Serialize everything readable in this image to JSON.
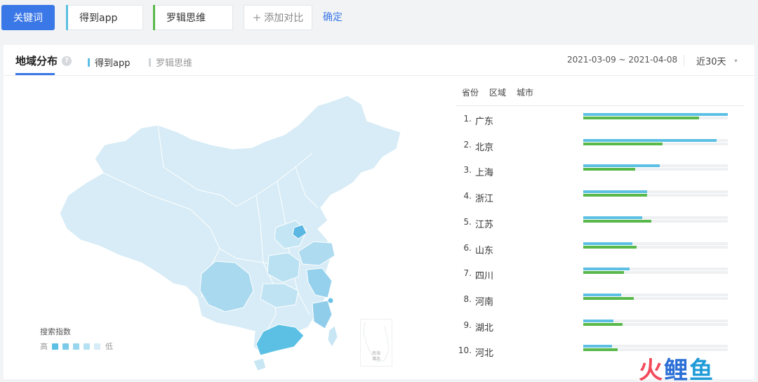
{
  "toolbar": {
    "keyword_button": "关键词",
    "keywords": [
      "得到app",
      "罗辑思维"
    ],
    "keyword_colors": [
      "#5bc0e4",
      "#58b94a"
    ],
    "add_compare": "添加对比",
    "confirm": "确定"
  },
  "panel": {
    "tab_title": "地域分布",
    "help_icon": "help-circle-icon",
    "legend": [
      "得到app",
      "罗辑思维"
    ],
    "date_range": "2021-03-09 ~ 2021-04-08",
    "period": "近30天"
  },
  "map": {
    "legend_title": "搜索指数",
    "legend_high": "高",
    "legend_low": "低",
    "legend_colors": [
      "#5bc0e4",
      "#7acbe9",
      "#98d6ee",
      "#b6e1f3",
      "#d6ecf6"
    ],
    "inset_labels": [
      "南海",
      "诸岛"
    ]
  },
  "rankings": {
    "tabs": [
      "省份",
      "区域",
      "城市"
    ],
    "items": [
      {
        "rank": "1.",
        "name": "广东",
        "a": 1.0,
        "b": 0.8
      },
      {
        "rank": "2.",
        "name": "北京",
        "a": 0.92,
        "b": 0.55
      },
      {
        "rank": "3.",
        "name": "上海",
        "a": 0.53,
        "b": 0.36
      },
      {
        "rank": "4.",
        "name": "浙江",
        "a": 0.44,
        "b": 0.44
      },
      {
        "rank": "5.",
        "name": "江苏",
        "a": 0.41,
        "b": 0.47
      },
      {
        "rank": "6.",
        "name": "山东",
        "a": 0.34,
        "b": 0.37
      },
      {
        "rank": "7.",
        "name": "四川",
        "a": 0.32,
        "b": 0.28
      },
      {
        "rank": "8.",
        "name": "河南",
        "a": 0.26,
        "b": 0.35
      },
      {
        "rank": "9.",
        "name": "湖北",
        "a": 0.21,
        "b": 0.27
      },
      {
        "rank": "10.",
        "name": "河北",
        "a": 0.2,
        "b": 0.24
      }
    ]
  },
  "watermark": [
    "火",
    "鲤",
    "鱼"
  ]
}
